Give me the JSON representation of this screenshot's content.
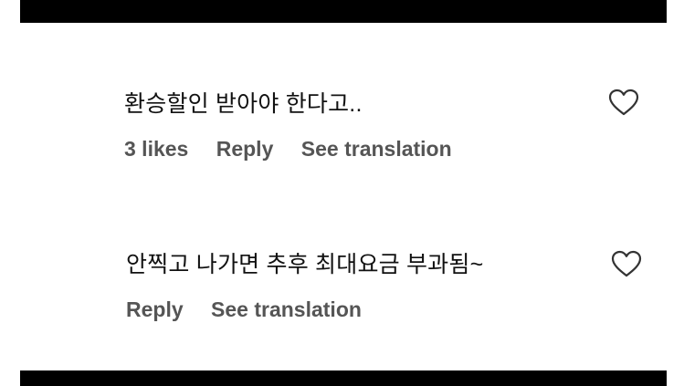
{
  "comments": [
    {
      "text": "환승할인 받아야 한다고..",
      "likes": "3 likes",
      "reply": "Reply",
      "translate": "See translation",
      "like_icon": "heart-outline-icon"
    },
    {
      "text": "안찍고 나가면 추후 최대요금 부과됨~",
      "reply": "Reply",
      "translate": "See translation",
      "like_icon": "heart-outline-icon"
    }
  ],
  "colors": {
    "text": "#111111",
    "meta": "#555555",
    "bars": "#000000"
  }
}
